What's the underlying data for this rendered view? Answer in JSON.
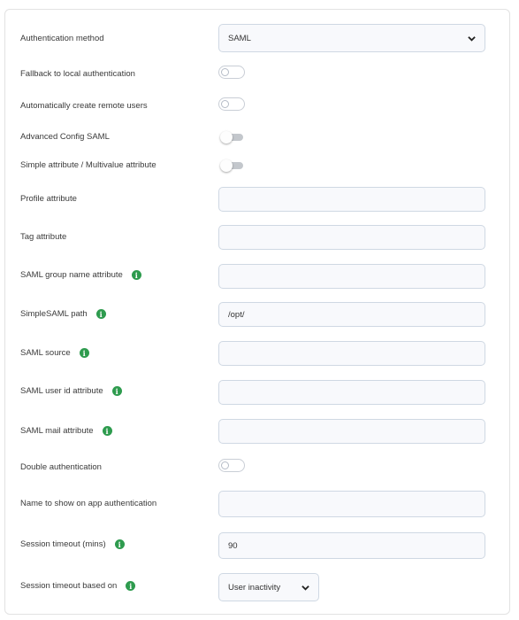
{
  "form": {
    "auth_method": {
      "label": "Authentication method",
      "value": "SAML"
    },
    "fallback_local": {
      "label": "Fallback to local authentication",
      "checked": false
    },
    "auto_create_users": {
      "label": "Automatically create remote users",
      "checked": false
    },
    "advanced_config_saml": {
      "label": "Advanced Config SAML",
      "checked": false
    },
    "simple_multivalue": {
      "label": "Simple attribute / Multivalue attribute",
      "checked": false
    },
    "profile_attribute": {
      "label": "Profile attribute",
      "value": ""
    },
    "tag_attribute": {
      "label": "Tag attribute",
      "value": ""
    },
    "saml_group_name_attribute": {
      "label": "SAML group name attribute",
      "value": ""
    },
    "simplesaml_path": {
      "label": "SimpleSAML path",
      "value": "/opt/"
    },
    "saml_source": {
      "label": "SAML source",
      "value": ""
    },
    "saml_user_id_attribute": {
      "label": "SAML user id attribute",
      "value": ""
    },
    "saml_mail_attribute": {
      "label": "SAML mail attribute",
      "value": ""
    },
    "double_authentication": {
      "label": "Double authentication",
      "checked": false
    },
    "name_on_app_auth": {
      "label": "Name to show on app authentication",
      "value": ""
    },
    "session_timeout": {
      "label": "Session timeout (mins)",
      "value": "90"
    },
    "session_timeout_based_on": {
      "label": "Session timeout based on",
      "value": "User inactivity"
    }
  },
  "icons": {
    "info": "info-icon",
    "dropdown": "chevron-down-icon"
  },
  "colors": {
    "info_icon": "#2e9b4e",
    "field_border": "#cfd8e3",
    "field_bg": "#f8f9fc"
  }
}
